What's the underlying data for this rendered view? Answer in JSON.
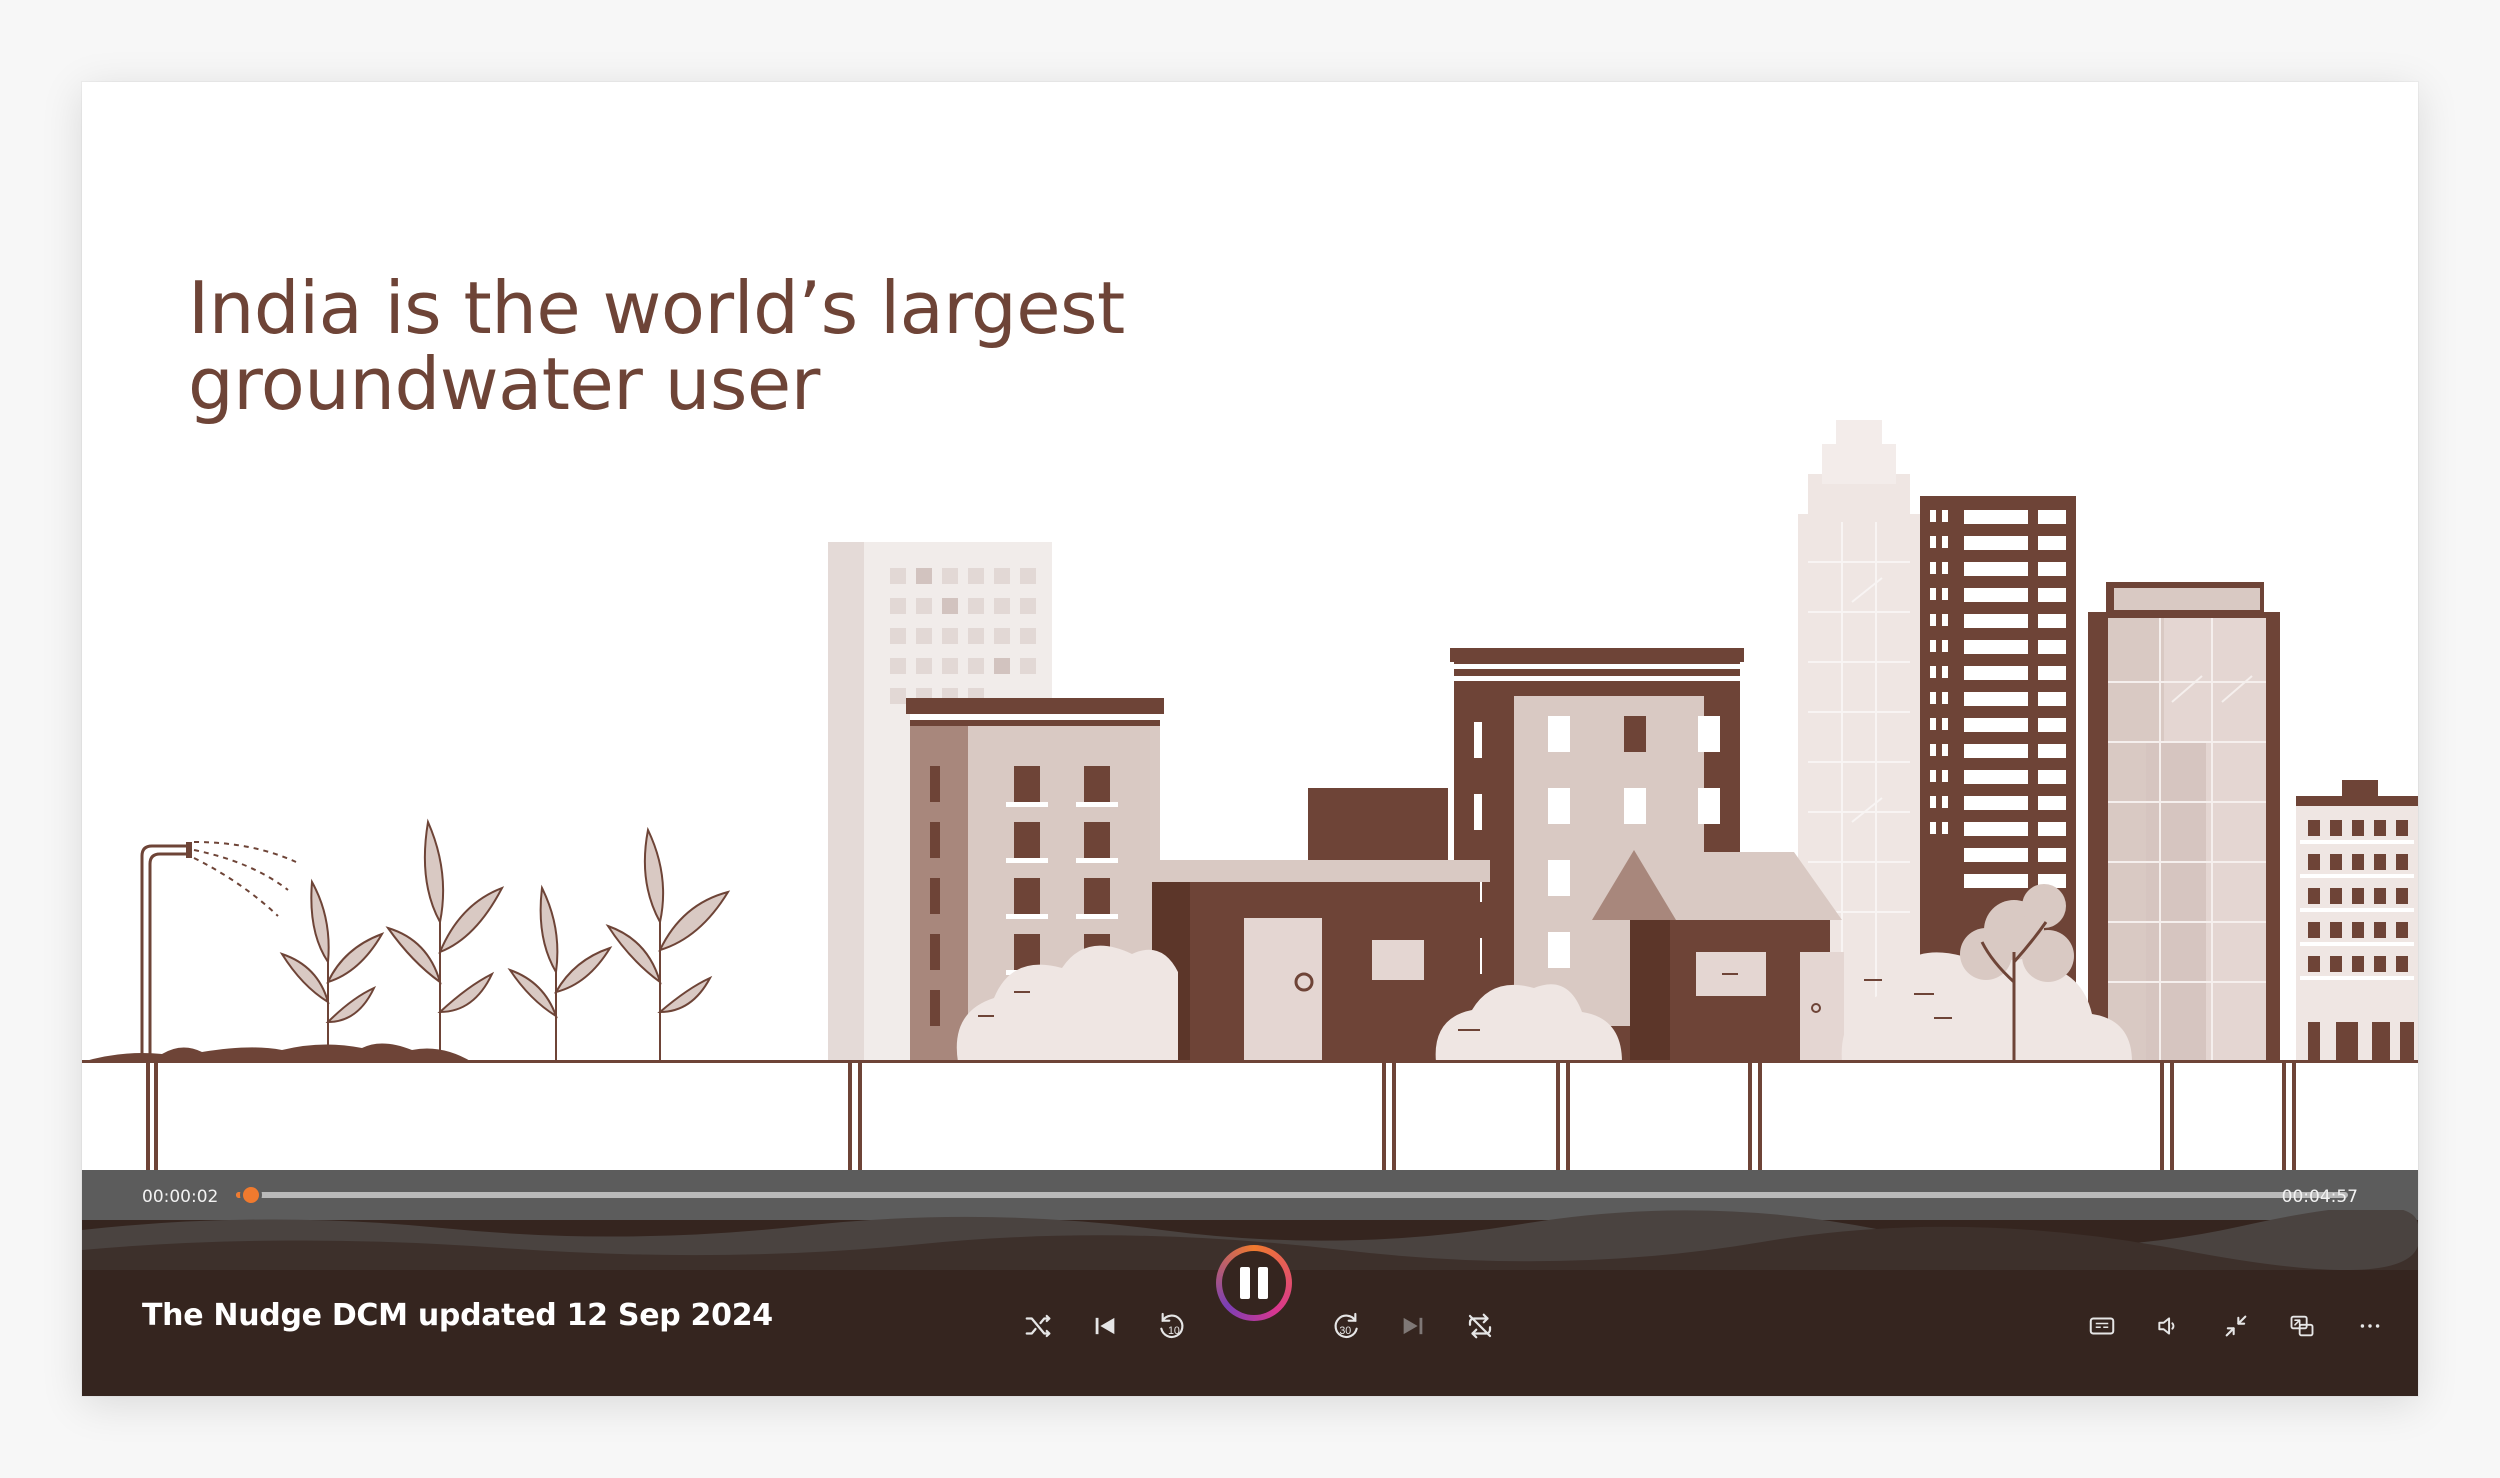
{
  "slide": {
    "headline_lines": [
      "India is the world’s largest",
      "groundwater user"
    ]
  },
  "player": {
    "title": "The Nudge DCM updated 12 Sep 2024",
    "elapsed": "00:00:02",
    "duration": "00:04:57",
    "progress_fraction": 0.007,
    "state": "playing",
    "accent_color": "#f07a2e",
    "controls": [
      "shuffle-icon",
      "previous-track-icon",
      "rewind-10-icon",
      "pause-icon",
      "forward-30-icon",
      "next-track-icon",
      "repeat-off-icon",
      "captions-icon",
      "volume-icon",
      "exit-fullscreen-icon",
      "mini-player-icon",
      "more-options-icon"
    ]
  },
  "colors": {
    "headline": "#6e4437",
    "building_dark": "#6e4437",
    "building_mid": "#a8877c",
    "building_light": "#d9c9c3",
    "control_bar": "#35251f"
  }
}
